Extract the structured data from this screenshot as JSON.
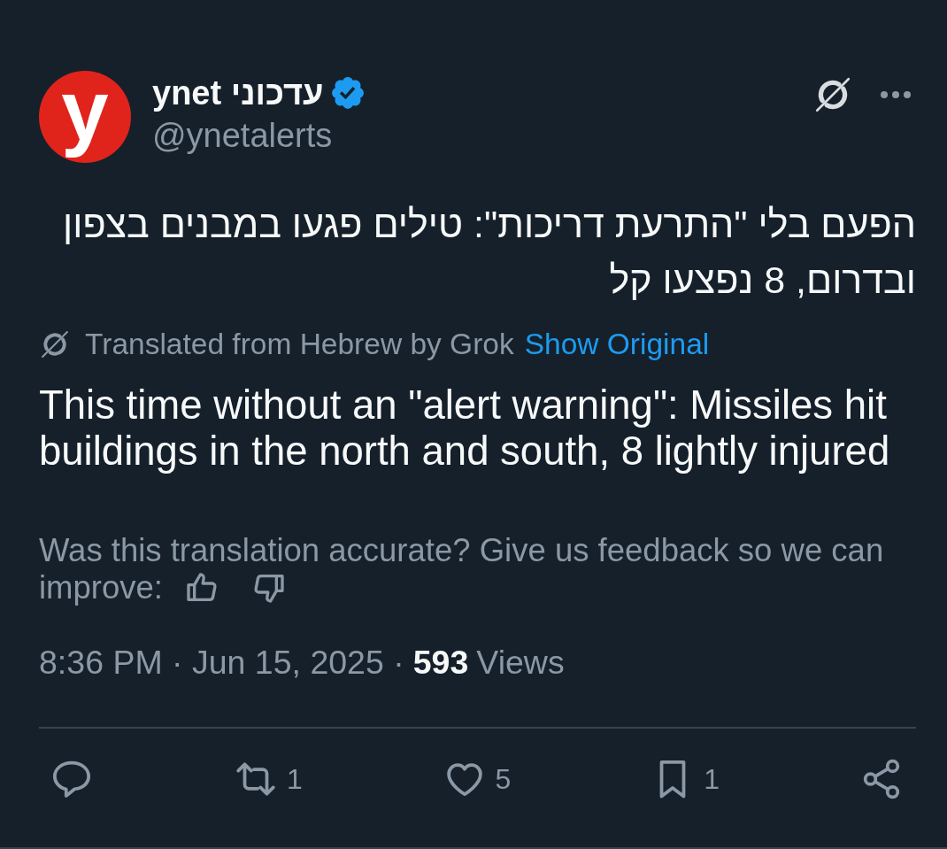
{
  "author": {
    "avatar_text": "y",
    "display_name": "עדכוני ynet",
    "verified": true,
    "handle": "@ynetalerts"
  },
  "original_text": "הפעם בלי \"התרעת דריכות\": טילים פגעו במבנים בצפון ובדרום, 8 נפצעו קל",
  "translation": {
    "note": "Translated from Hebrew by Grok",
    "toggle_link": "Show Original",
    "text": "This time without an \"alert warning\": Missiles hit buildings in the north and south, 8 lightly injured"
  },
  "feedback": {
    "prompt_lines": [
      "Was this translation accurate? Give us feedback so we can",
      "improve:"
    ]
  },
  "meta": {
    "posted": "8:36 PM · Jun 15, 2025 ·",
    "views_count": "593",
    "views_label": "Views"
  },
  "actions": [
    {
      "kind": "reply"
    },
    {
      "kind": "repost",
      "count": "1"
    },
    {
      "kind": "like",
      "count": "5"
    },
    {
      "kind": "bookmark",
      "count": "1"
    },
    {
      "kind": "share"
    }
  ]
}
